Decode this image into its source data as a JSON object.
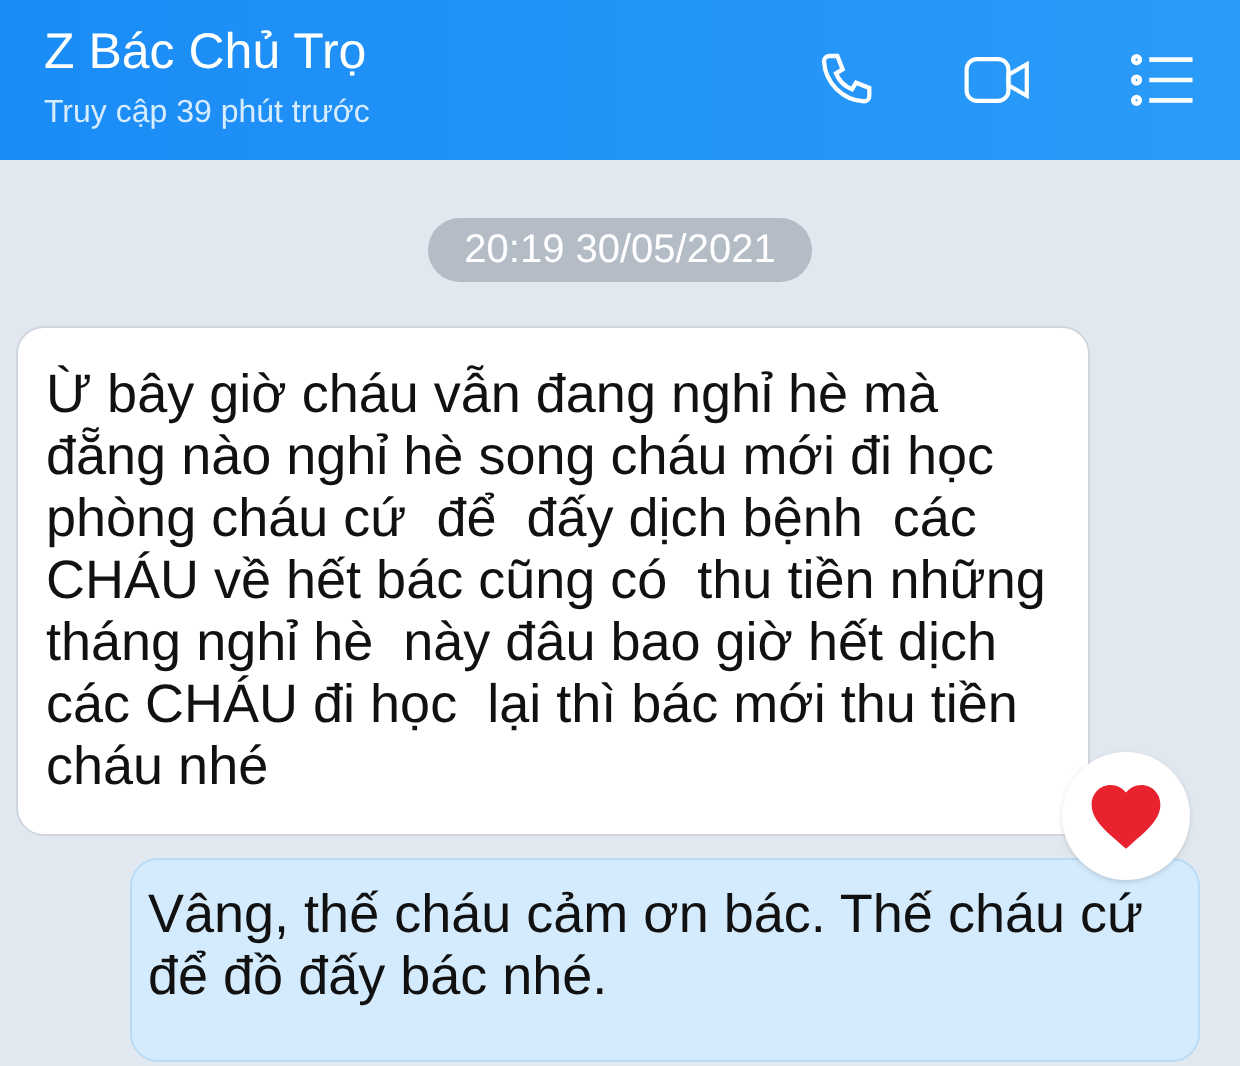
{
  "header": {
    "title": "Z Bác Chủ Trọ",
    "subtitle": "Truy cập 39 phút trước"
  },
  "messages": [
    {
      "kind": "timestamp",
      "text": "20:19 30/05/2021"
    },
    {
      "kind": "incoming",
      "text": "Ừ bây giờ cháu vẫn đang nghỉ hè mà đẵng nào nghỉ hè song cháu mới đi học phòng cháu cứ  để  đấy dịch bệnh  các CHÁU về hết bác cũng có  thu tiền những tháng nghỉ hè  này đâu bao giờ hết dịch các CHÁU đi học  lại thì bác mới thu tiền  cháu nhé",
      "heart_reaction": true
    },
    {
      "kind": "outgoing",
      "text": "Vâng, thế cháu cảm ơn bác. Thế cháu cứ để đồ đấy bác nhé."
    }
  ]
}
